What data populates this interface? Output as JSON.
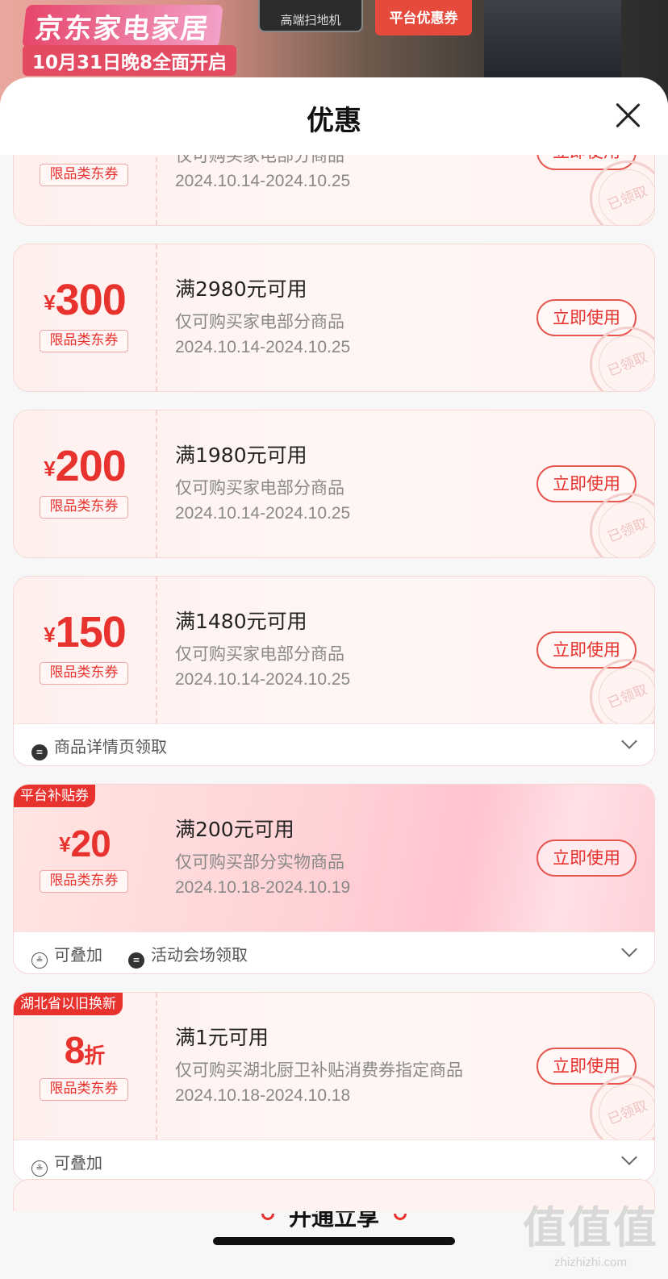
{
  "banner": {
    "title": "京东家电家居",
    "subtitle": "10月31日晚8全面开启",
    "product_label": "高端扫地机",
    "platform_label": "平台优惠券"
  },
  "sheet": {
    "title": "优惠"
  },
  "coupons": [
    {
      "amount_prefix": "",
      "amount": "",
      "amount_unit": "",
      "tag": "限品类东券",
      "title": "",
      "desc": "仅可购买家电部分商品",
      "date": "2024.10.14-2024.10.25",
      "button": "立即使用",
      "stamp": "已领取"
    },
    {
      "amount_prefix": "¥",
      "amount": "300",
      "amount_unit": "",
      "tag": "限品类东券",
      "title": "满2980元可用",
      "desc": "仅可购买家电部分商品",
      "date": "2024.10.14-2024.10.25",
      "button": "立即使用",
      "stamp": "已领取"
    },
    {
      "amount_prefix": "¥",
      "amount": "200",
      "amount_unit": "",
      "tag": "限品类东券",
      "title": "满1980元可用",
      "desc": "仅可购买家电部分商品",
      "date": "2024.10.14-2024.10.25",
      "button": "立即使用",
      "stamp": "已领取"
    },
    {
      "amount_prefix": "¥",
      "amount": "150",
      "amount_unit": "",
      "tag": "限品类东券",
      "title": "满1480元可用",
      "desc": "仅可购买家电部分商品",
      "date": "2024.10.14-2024.10.25",
      "button": "立即使用",
      "stamp": "已领取",
      "footer": [
        "商品详情页领取"
      ]
    },
    {
      "badge": "平台补贴券",
      "amount_prefix": "¥",
      "amount": "20",
      "amount_unit": "",
      "tag": "限品类东券",
      "title": "满200元可用",
      "desc": "仅可购买部分实物商品",
      "date": "2024.10.18-2024.10.19",
      "button": "立即使用",
      "footer": [
        "可叠加",
        "活动会场领取"
      ]
    },
    {
      "badge": "湖北省以旧换新",
      "amount_prefix": "",
      "amount": "8",
      "amount_unit": "折",
      "tag": "限品类东券",
      "title": "满1元可用",
      "desc": "仅可购买湖北厨卫补贴消费券指定商品",
      "date": "2024.10.18-2024.10.18",
      "button": "立即使用",
      "stamp": "已领取",
      "footer": [
        "可叠加"
      ]
    }
  ],
  "open_bar": {
    "label": "开通立享"
  },
  "watermark": {
    "big": "值值值",
    "small": "zhizhizhi.com"
  }
}
